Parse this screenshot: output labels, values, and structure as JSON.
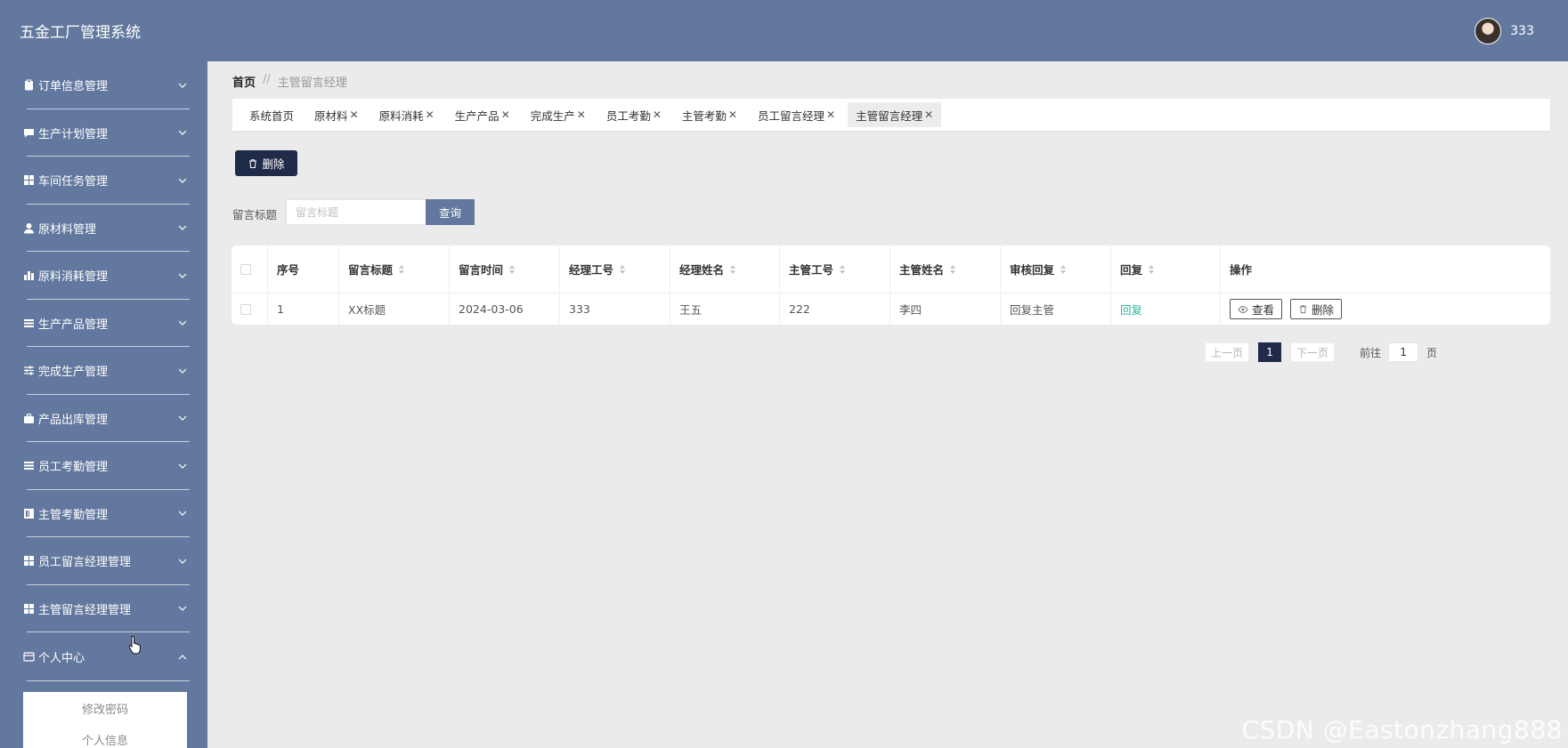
{
  "header": {
    "app_title": "五金工厂管理系统",
    "user_name": "333"
  },
  "sidebar": {
    "items": [
      {
        "label": "订单信息管理",
        "icon": "clipboard-icon"
      },
      {
        "label": "生产计划管理",
        "icon": "chat-icon"
      },
      {
        "label": "车间任务管理",
        "icon": "grid-icon"
      },
      {
        "label": "原材料管理",
        "icon": "user-icon"
      },
      {
        "label": "原料消耗管理",
        "icon": "bar-chart-icon"
      },
      {
        "label": "生产产品管理",
        "icon": "list-icon"
      },
      {
        "label": "完成生产管理",
        "icon": "sliders-icon"
      },
      {
        "label": "产品出库管理",
        "icon": "briefcase-icon"
      },
      {
        "label": "员工考勤管理",
        "icon": "list-icon"
      },
      {
        "label": "主管考勤管理",
        "icon": "calendar-icon"
      },
      {
        "label": "员工留言经理管理",
        "icon": "grid-icon"
      },
      {
        "label": "主管留言经理管理",
        "icon": "grid-icon"
      },
      {
        "label": "个人中心",
        "icon": "card-icon"
      }
    ],
    "submenu": [
      "修改密码",
      "个人信息"
    ]
  },
  "breadcrumb": {
    "home": "首页",
    "separator": "//",
    "current": "主管留言经理"
  },
  "tabs": [
    {
      "label": "系统首页",
      "closable": false
    },
    {
      "label": "原材料",
      "closable": true
    },
    {
      "label": "原料消耗",
      "closable": true
    },
    {
      "label": "生产产品",
      "closable": true
    },
    {
      "label": "完成生产",
      "closable": true
    },
    {
      "label": "员工考勤",
      "closable": true
    },
    {
      "label": "主管考勤",
      "closable": true
    },
    {
      "label": "员工留言经理",
      "closable": true
    },
    {
      "label": "主管留言经理",
      "closable": true,
      "active": true
    }
  ],
  "toolbar": {
    "delete_label": "删除"
  },
  "search": {
    "label": "留言标题",
    "placeholder": "留言标题",
    "value": "",
    "button_label": "查询"
  },
  "table": {
    "headers": [
      "序号",
      "留言标题",
      "留言时间",
      "经理工号",
      "经理姓名",
      "主管工号",
      "主管姓名",
      "审核回复",
      "回复",
      "操作"
    ],
    "rows": [
      {
        "index": "1",
        "title": "XX标题",
        "time": "2024-03-06",
        "manager_id": "333",
        "manager_name": "王五",
        "supervisor_id": "222",
        "supervisor_name": "李四",
        "review_reply": "回复主管",
        "reply": "回复",
        "view_label": "查看",
        "delete_label": "删除"
      }
    ]
  },
  "pagination": {
    "prev": "上一页",
    "current_page": "1",
    "next": "下一页",
    "goto_label": "前往",
    "goto_value": "1",
    "page_suffix": "页"
  },
  "watermark": "CSDN @Eastonzhang888",
  "colors": {
    "header_bg": "#62789e",
    "sidebar_bg": "#62789e",
    "primary_dark": "#1f2b48",
    "link_green": "#29b59c",
    "content_bg": "#ebebeb"
  }
}
